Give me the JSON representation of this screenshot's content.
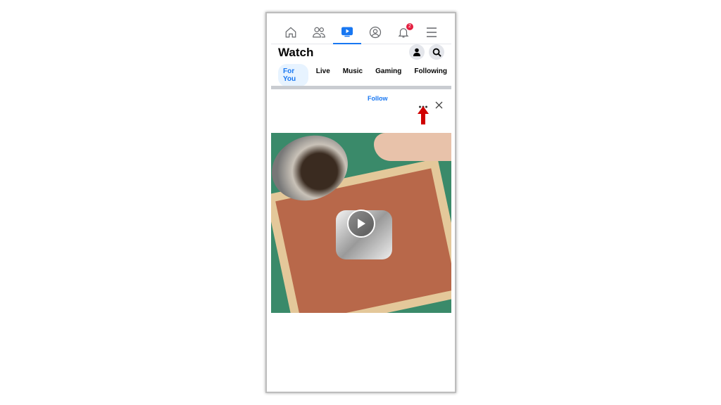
{
  "nav": {
    "items": [
      "home-icon",
      "friends-icon",
      "watch-icon",
      "profile-icon",
      "bell-icon",
      "menu-icon"
    ],
    "active": "watch",
    "notification_count": "2"
  },
  "header": {
    "title": "Watch"
  },
  "tabs": [
    {
      "label": "For You",
      "selected": true
    },
    {
      "label": "Live"
    },
    {
      "label": "Music"
    },
    {
      "label": "Gaming"
    },
    {
      "label": "Following"
    }
  ],
  "post": {
    "follow_label": "Follow"
  },
  "colors": {
    "accent": "#1877f2",
    "annotation_arrow": "#d00000",
    "badge": "#e41e3f"
  }
}
